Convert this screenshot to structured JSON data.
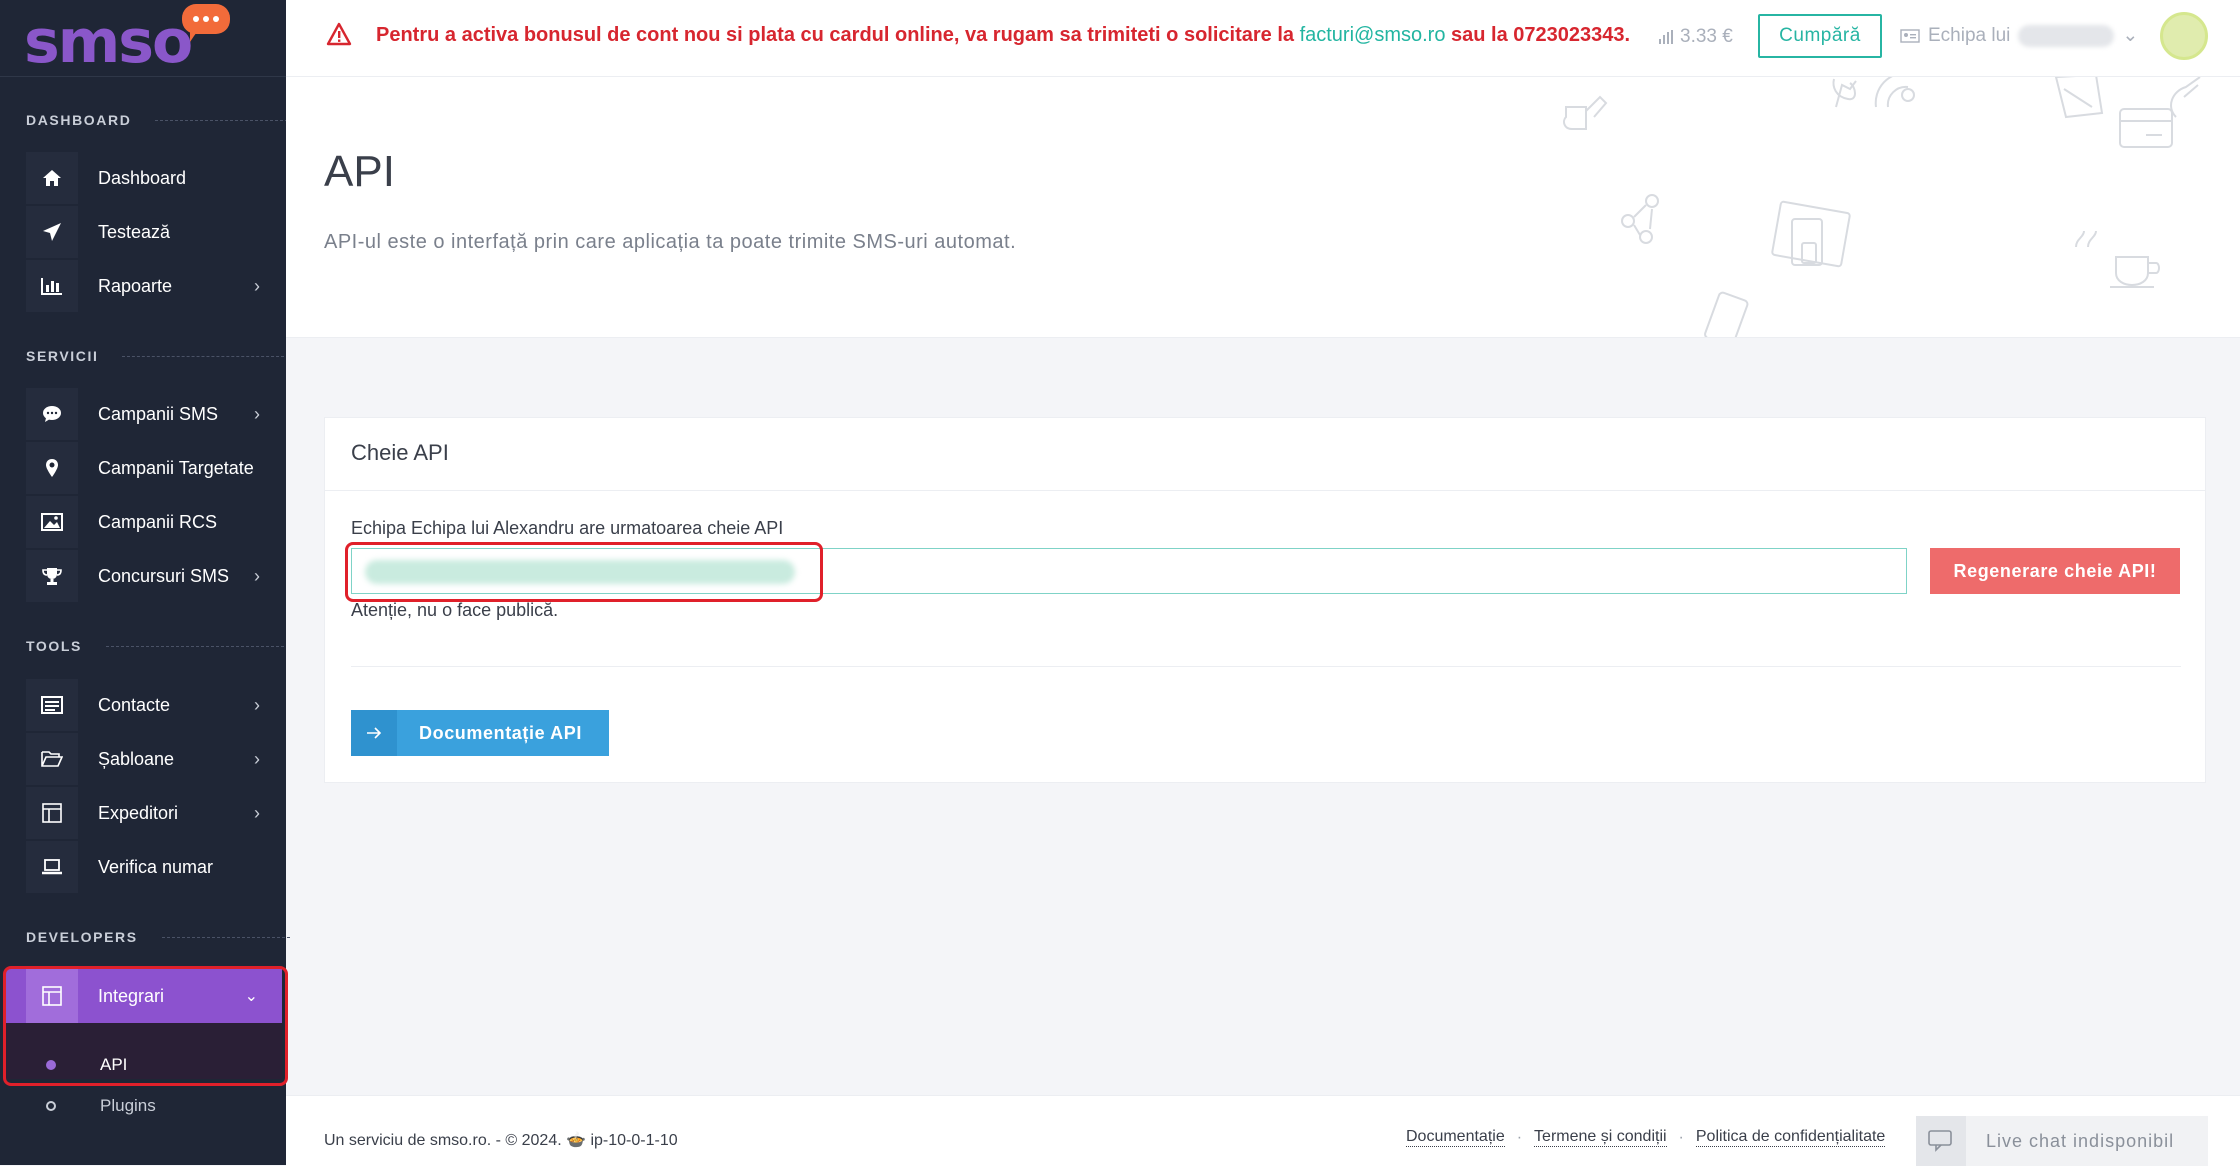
{
  "brand": {
    "logo_text": "smso",
    "accent": "#8c52cf"
  },
  "sidebar": {
    "sections": {
      "dashboard": "DASHBOARD",
      "servicii": "SERVICII",
      "tools": "TOOLS",
      "developers": "DEVELOPERS"
    },
    "items": {
      "dashboard": "Dashboard",
      "testeaza": "Testează",
      "rapoarte": "Rapoarte",
      "campanii_sms": "Campanii SMS",
      "campanii_targetate": "Campanii Targetate",
      "campanii_rcs": "Campanii RCS",
      "concursuri_sms": "Concursuri SMS",
      "contacte": "Contacte",
      "sabloane": "Șabloane",
      "expeditori": "Expeditori",
      "verifica_numar": "Verifica numar",
      "integrari": "Integrari",
      "api": "API",
      "plugins": "Plugins"
    }
  },
  "topbar": {
    "alert_prefix": "Pentru a activa bonusul de cont nou si plata cu cardul online, va rugam sa trimiteti o solicitare la ",
    "alert_email": "facturi@smso.ro",
    "alert_suffix": " sau la 0723023343.",
    "balance": "3.33 €",
    "buy_label": "Cumpără",
    "team_label": "Echipa lui"
  },
  "header": {
    "title": "API",
    "subtitle": "API-ul este o interfață prin care aplicația ta poate trimite SMS-uri automat."
  },
  "card": {
    "title": "Cheie API",
    "key_label": "Echipa Echipa lui Alexandru are urmatoarea cheie API",
    "regen_label": "Regenerare cheie API!",
    "warning": "Atenție, nu o face publică.",
    "doc_label": "Documentație API"
  },
  "footer": {
    "left": "Un serviciu de smso.ro. - © 2024. 🍲 ip-10-0-1-10",
    "links": [
      "Documentație",
      "Termene și condiții",
      "Politica de confidențialitate"
    ],
    "chat_label": "Live chat indisponibil"
  }
}
